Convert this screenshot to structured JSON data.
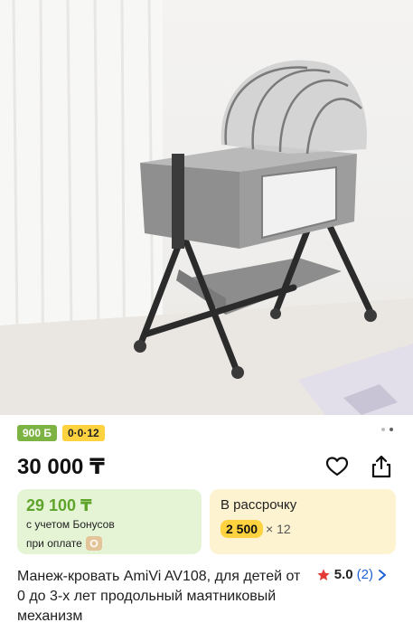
{
  "product": {
    "title": "Манеж-кровать AmiVi AV108, для детей от 0 до 3-х лет продольный маятниковый механизм",
    "image_alt": "Манеж-кровать AmiVi AV108"
  },
  "badges": {
    "bonus": "900 Б",
    "installment": "0·0·12"
  },
  "gallery": {
    "dots": 2,
    "active_index": 1
  },
  "price": {
    "main": "30 000 ₸"
  },
  "bonus_card": {
    "price": "29 100 ₸",
    "line1": "с учетом Бонусов",
    "line2": "при оплате"
  },
  "installment_card": {
    "title": "В рассрочку",
    "amount": "2 500",
    "multiplier": "× 12"
  },
  "rating": {
    "score": "5.0",
    "count": "(2)"
  },
  "icons": {
    "favorite": "heart-icon",
    "share": "share-icon",
    "star": "star-icon",
    "chevron": "chevron-right-icon",
    "bonus": "bonus-icon"
  },
  "colors": {
    "green_badge": "#7cb342",
    "yellow_badge": "#ffd23f",
    "green_card": "#e6f4d6",
    "yellow_card": "#fdf3d1",
    "link_blue": "#1e63d6",
    "star_red": "#e53935"
  }
}
